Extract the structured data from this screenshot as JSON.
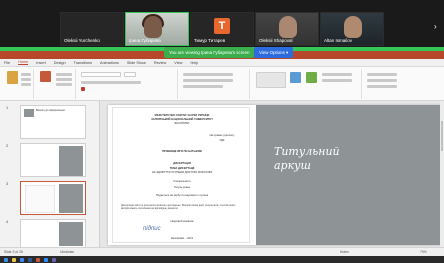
{
  "participants": [
    {
      "name": "Oleksii Yurchenko",
      "type": "name-only"
    },
    {
      "name": "Oleksii Yurchenko",
      "type": "video"
    },
    {
      "name": "Ірина Губарева",
      "type": "video-active"
    },
    {
      "name": "Тимур Титарев",
      "type": "avatar",
      "initial": "T"
    },
    {
      "name": "Oleksii Shapoval",
      "type": "video"
    },
    {
      "name": "Altan Ismailov",
      "type": "video"
    }
  ],
  "share": {
    "banner": "You are viewing Ірина Губарева's screen",
    "view_options": "View Options ▾"
  },
  "ppt": {
    "tabs": [
      "File",
      "Home",
      "Insert",
      "Design",
      "Transitions",
      "Animations",
      "Slide Show",
      "Review",
      "View",
      "Help"
    ],
    "selected_tab": "Home",
    "slide_title_line1": "Титульний",
    "slide_title_line2": "аркуш",
    "doc": {
      "ministry": "МІНІСТЕРСТВО ОСВІТИ І НАУКИ УКРАЇНИ",
      "institution": "ЗАПОРІЗЬКИЙ НАЦІОНАЛЬНИЙ УНІВЕРСИТЕТ",
      "faculty": "ФАКУЛЬТЕТ",
      "rights": "На правах рукопису",
      "udc": "УДК",
      "author": "ПРІЗВИЩЕ ІМ'Я ПО БАТЬКОВІ",
      "type": "ДИСЕРТАЦІЯ",
      "topic1": "ТЕМА ДИСЕРТАЦІЇ",
      "topic2": "НА ЗДОБУТТЯ СТУПЕНЯ ДОКТОРА ФІЛОСОФІЇ",
      "specialty": "Спеціальність",
      "field": "Галузь знань",
      "degree": "Подається на здобуття наукового ступеня",
      "para": "Дисертація містить результати власних досліджень. Використання ідей, результатів і текстів інших авторів мають посилання на відповідне джерело",
      "supervisor": "Науковий керівник",
      "city_year": "Запоріжжя – 2021",
      "signature": "підпис"
    },
    "status_left": "Slide 3 of 28",
    "status_lang": "Ukrainian",
    "status_right": "Notes",
    "zoom": "79%"
  },
  "thumbs": [
    {
      "num": "1",
      "title": "Вимоги до оформлення"
    },
    {
      "num": "2",
      "title": ""
    },
    {
      "num": "3",
      "title": ""
    },
    {
      "num": "4",
      "title": ""
    },
    {
      "num": "5",
      "title": ""
    }
  ]
}
